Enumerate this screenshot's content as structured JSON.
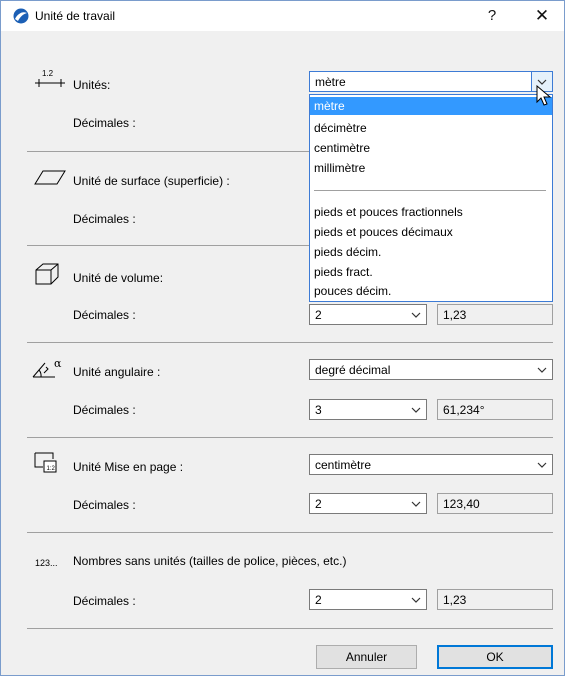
{
  "window": {
    "title": "Unité de travail",
    "help_label": "?",
    "close_label": "✕"
  },
  "sections": {
    "units": {
      "label": "Unités:",
      "value": "mètre",
      "decimals_label": "Décimales :"
    },
    "surface": {
      "label": "Unité de surface (superficie) :",
      "decimals_label": "Décimales :"
    },
    "volume": {
      "label": "Unité de volume:",
      "decimals_label": "Décimales :",
      "decimals_value": "2",
      "preview": "1,23"
    },
    "angle": {
      "label": "Unité angulaire :",
      "value": "degré décimal",
      "decimals_label": "Décimales :",
      "decimals_value": "3",
      "preview": "61,234°"
    },
    "layout": {
      "label": "Unité Mise en page :",
      "value": "centimètre",
      "decimals_label": "Décimales :",
      "decimals_value": "2",
      "preview": "123,40"
    },
    "unitless": {
      "icon_text": "123...",
      "label": "Nombres sans unités (tailles de police, pièces, etc.)",
      "decimals_label": "Décimales :",
      "decimals_value": "2",
      "preview": "1,23"
    }
  },
  "dropdown": {
    "metric": [
      "mètre",
      "décimètre",
      "centimètre",
      "millimètre"
    ],
    "imperial": [
      "pieds et pouces fractionnels",
      "pieds et pouces décimaux",
      "pieds décim.",
      "pieds fract.",
      "pouces décim."
    ]
  },
  "icons": {
    "units": "ruler-1.2-icon",
    "surface": "parallelogram-icon",
    "volume": "cube-icon",
    "angle": "angle-alpha-icon",
    "layout": "layout-page-icon"
  },
  "footer": {
    "cancel_label": "Annuler",
    "ok_label": "OK"
  },
  "colors": {
    "accent": "#0078d7",
    "selection": "#3399ff",
    "dialog_bg": "#f0f0f0"
  }
}
